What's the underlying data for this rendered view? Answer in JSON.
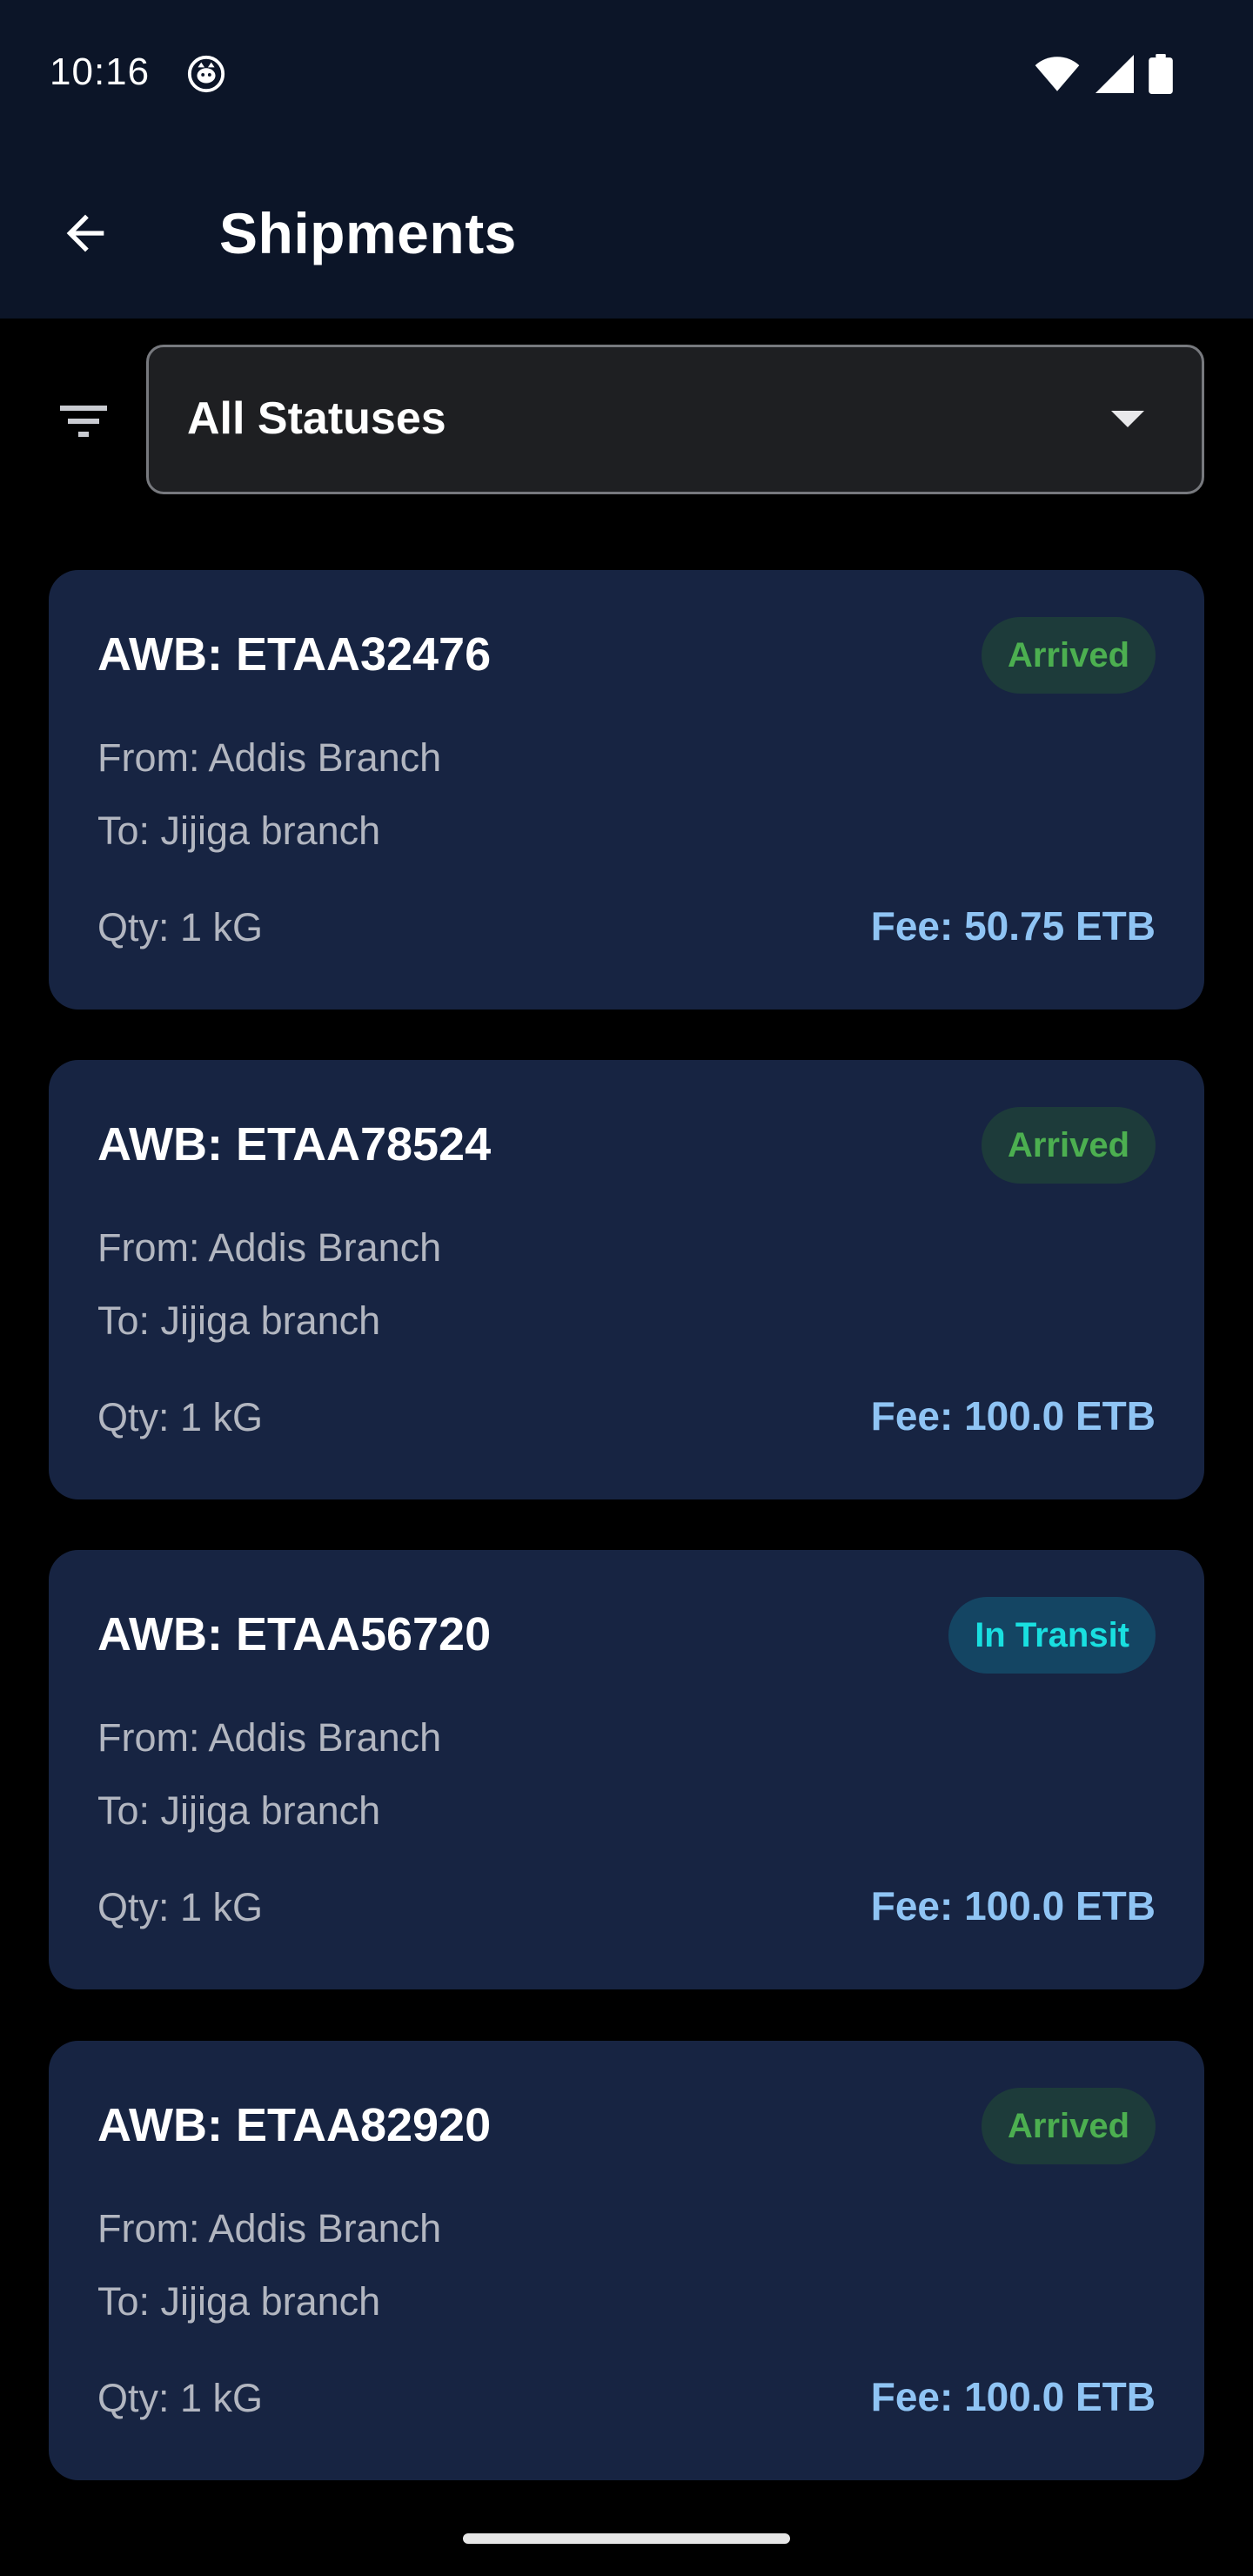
{
  "status_bar": {
    "time": "10:16",
    "icons": [
      "cat-notification-icon",
      "wifi-icon",
      "signal-icon",
      "battery-icon"
    ]
  },
  "app_bar": {
    "title": "Shipments",
    "back_icon": "arrow-back-icon"
  },
  "filter": {
    "icon": "filter-list-icon",
    "selected": "All Statuses"
  },
  "colors": {
    "background": "#000000",
    "app_bar": "#0c1528",
    "card": "#172442",
    "arrived_text": "#4caf50",
    "arrived_bg": "#1d3b3a",
    "transit_text": "#19dfe0",
    "transit_bg": "#144563",
    "fee_text": "#8fc4f4"
  },
  "shipments": [
    {
      "awb": "AWB: ETAA32476",
      "status": "Arrived",
      "from": "From: Addis Branch",
      "to": "To: Jijiga branch",
      "qty": "Qty: 1 kG",
      "fee": "Fee: 50.75 ETB"
    },
    {
      "awb": "AWB: ETAA78524",
      "status": "Arrived",
      "from": "From: Addis Branch",
      "to": "To: Jijiga branch",
      "qty": "Qty: 1 kG",
      "fee": "Fee: 100.0 ETB"
    },
    {
      "awb": "AWB: ETAA56720",
      "status": "In Transit",
      "from": "From: Addis Branch",
      "to": "To: Jijiga branch",
      "qty": "Qty: 1 kG",
      "fee": "Fee: 100.0 ETB"
    },
    {
      "awb": "AWB: ETAA82920",
      "status": "Arrived",
      "from": "From: Addis Branch",
      "to": "To: Jijiga branch",
      "qty": "Qty: 1 kG",
      "fee": "Fee: 100.0 ETB"
    }
  ]
}
